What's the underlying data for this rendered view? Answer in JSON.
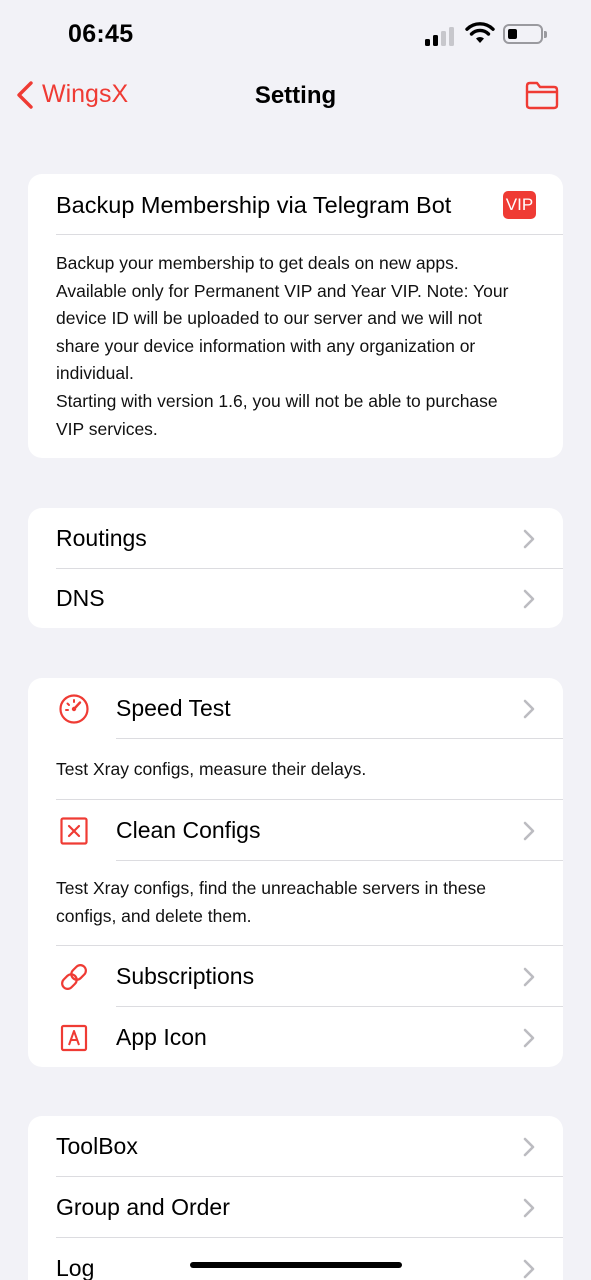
{
  "status_bar": {
    "time": "06:45"
  },
  "nav": {
    "back_label": "WingsX",
    "title": "Setting",
    "folder_icon": "folder-icon"
  },
  "accent_color": "#ef3b34",
  "backup_card": {
    "title": "Backup Membership via Telegram Bot",
    "badge": "VIP",
    "description_lines": [
      "Backup your membership to get deals on new apps.",
      "Available only for Permanent VIP and Year VIP. Note: Your",
      "device ID will be uploaded to our server and we will not",
      "share your device information with any organization or",
      "individual.",
      "Starting with version 1.6, you will not be able to purchase",
      "VIP services."
    ]
  },
  "network_card": {
    "routings": "Routings",
    "dns": "DNS"
  },
  "tools_card": {
    "speed_test": {
      "label": "Speed Test",
      "icon": "speedometer-icon",
      "description": "Test Xray configs, measure their delays."
    },
    "clean_configs": {
      "label": "Clean Configs",
      "icon": "x-square-icon",
      "description_lines": [
        "Test Xray configs, find the unreachable servers in these",
        "configs, and delete them."
      ]
    },
    "subscriptions": {
      "label": "Subscriptions",
      "icon": "link-icon"
    },
    "app_icon": {
      "label": "App Icon",
      "icon": "a-square-icon"
    }
  },
  "misc_card": {
    "toolbox": "ToolBox",
    "group_order": "Group and Order",
    "log": "Log"
  }
}
